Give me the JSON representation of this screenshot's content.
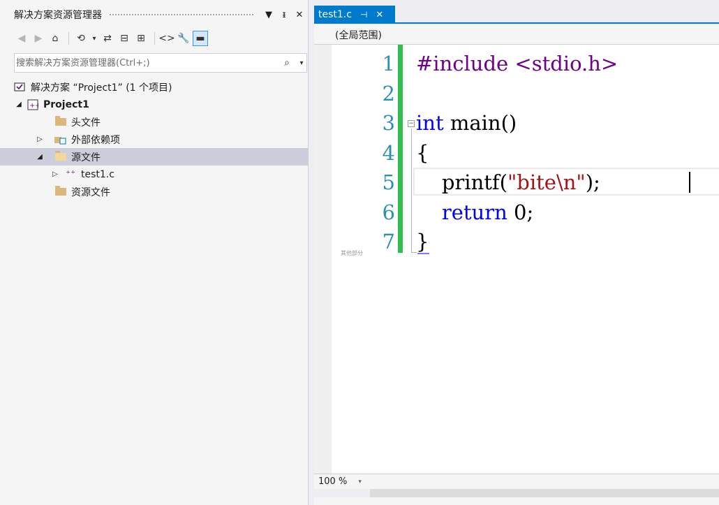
{
  "solution_explorer": {
    "title": "解决方案资源管理器",
    "title_buttons": [
      "▼",
      "ᵻ",
      "✕"
    ],
    "toolbar": {
      "back": "◀",
      "forward": "▶",
      "home": "⌂",
      "history": "⟲",
      "history_dd": "▾",
      "sync": "⇄",
      "collapse": "⊟",
      "show_all": "⊞",
      "code": "<>",
      "properties": "🔧",
      "preview": "▬"
    },
    "search": {
      "placeholder": "搜索解决方案资源管理器(Ctrl+;)",
      "icon": "⌕",
      "dd": "▾"
    },
    "tree": {
      "solution": {
        "label": "解决方案 “Project1” (1 个项目)"
      },
      "project": {
        "arrow": "◢",
        "label": "Project1"
      },
      "headers": {
        "label": "头文件"
      },
      "external": {
        "arrow": "▷",
        "label": "外部依赖项"
      },
      "sources": {
        "arrow": "◢",
        "label": "源文件"
      },
      "file": {
        "arrow": "▷",
        "icon": "⁺⁺",
        "label": "test1.c"
      },
      "resources": {
        "label": "资源文件"
      }
    }
  },
  "editor": {
    "tab": {
      "label": "test1.c",
      "pin": "⊣",
      "close": "✕"
    },
    "scope": "(全局范围)",
    "gutter_note": "其他部分",
    "collapse_glyph": "−",
    "lines": [
      {
        "n": "1",
        "parts": [
          {
            "c": "pp",
            "t": "#include <stdio.h>"
          }
        ]
      },
      {
        "n": "2",
        "parts": []
      },
      {
        "n": "3",
        "parts": [
          {
            "c": "kw",
            "t": "int"
          },
          {
            "c": "ink",
            "t": " main()"
          }
        ]
      },
      {
        "n": "4",
        "parts": [
          {
            "c": "ink",
            "t": "{"
          }
        ]
      },
      {
        "n": "5",
        "parts": [
          {
            "c": "ink",
            "t": "    printf("
          },
          {
            "c": "str",
            "t": "\"bite\\n\""
          },
          {
            "c": "ink",
            "t": ");"
          }
        ]
      },
      {
        "n": "6",
        "parts": [
          {
            "c": "kw",
            "t": "    return"
          },
          {
            "c": "ink",
            "t": " 0;"
          }
        ]
      },
      {
        "n": "7",
        "parts": [
          {
            "c": "ink",
            "t": "}"
          }
        ]
      }
    ],
    "zoom": "100 %",
    "zoom_dd": "▾"
  }
}
